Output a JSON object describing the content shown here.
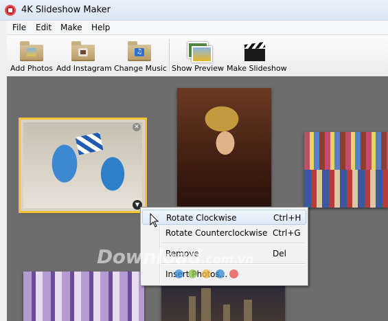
{
  "window": {
    "title": "4K Slideshow Maker"
  },
  "menu": [
    "File",
    "Edit",
    "Make",
    "Help"
  ],
  "toolbar": {
    "add_photos": "Add Photos",
    "add_instagram": "Add Instagram",
    "change_music": "Change Music",
    "show_preview": "Show Preview",
    "make_slideshow": "Make Slideshow"
  },
  "context_menu": {
    "rotate_cw": {
      "label": "Rotate Clockwise",
      "shortcut": "Ctrl+H"
    },
    "rotate_ccw": {
      "label": "Rotate Counterclockwise",
      "shortcut": "Ctrl+G"
    },
    "remove": {
      "label": "Remove",
      "shortcut": "Del"
    },
    "insert": {
      "label": "Insert Photos..."
    }
  },
  "watermark": {
    "text": "Download",
    "suffix": ".com.vn"
  },
  "colors": {
    "selection": "#f3c431",
    "canvas": "#6d6d6d",
    "dots": [
      "#3a8fe0",
      "#8cc34a",
      "#f0b43c",
      "#2f86cf",
      "#e84c4c"
    ]
  },
  "icons": {
    "app": "app-logo-icon",
    "add_photos": "photo-folder-icon",
    "add_instagram": "instagram-folder-icon",
    "change_music": "music-folder-icon",
    "show_preview": "preview-photos-icon",
    "make_slideshow": "clapperboard-icon"
  }
}
